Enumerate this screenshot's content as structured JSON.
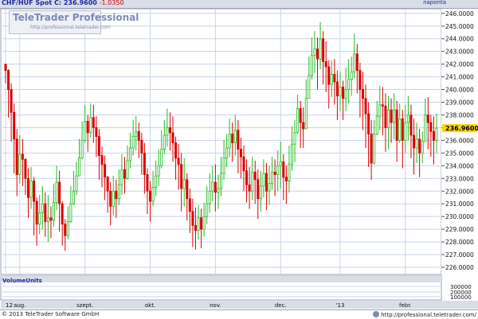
{
  "header": {
    "symbol_label": "CHF/HUF Spot",
    "last_label": "C: 236.9600",
    "change_label": "-1.0350",
    "period_label": "naponta"
  },
  "logo": {
    "name": "TeleTrader Professional",
    "url": "http://professional.teletrader.com"
  },
  "volume": {
    "label": "VolumeUnits",
    "ticks": [
      "300000",
      "200000",
      "100000"
    ]
  },
  "footer": {
    "copyright": "© 2013 TeleTrader Software GmbH",
    "url": "http://professional.teletrader.com/"
  },
  "colors": {
    "up": "#22bb22",
    "down": "#dd0000",
    "grid": "#c9d3e6",
    "axis_bg": "#d8dde8",
    "price_tag": "#ffd400"
  },
  "chart_data": {
    "type": "candlestick",
    "ylim": [
      225.5,
      246.3
    ],
    "yticks": [
      "226.0000",
      "227.0000",
      "228.0000",
      "229.0000",
      "230.0000",
      "231.0000",
      "232.0000",
      "233.0000",
      "234.0000",
      "235.0000",
      "236.0000",
      "237.0000",
      "238.0000",
      "239.0000",
      "240.0000",
      "241.0000",
      "242.0000",
      "243.0000",
      "244.0000",
      "245.0000",
      "246.0000"
    ],
    "last_price": "236.9600",
    "x_labels": [
      {
        "label": "12",
        "idx": 0
      },
      {
        "label": "aug.",
        "idx": 5
      },
      {
        "label": "szept.",
        "idx": 28
      },
      {
        "label": "okt.",
        "idx": 51
      },
      {
        "label": "nov.",
        "idx": 74
      },
      {
        "label": "dec.",
        "idx": 97
      },
      {
        "label": "'13",
        "idx": 118
      },
      {
        "label": "febr.",
        "idx": 141
      }
    ],
    "close": [
      241.5,
      240.0,
      238.2,
      236.1,
      233.3,
      234.9,
      234.5,
      233.0,
      231.5,
      232.8,
      231.2,
      229.4,
      230.3,
      231.0,
      229.6,
      229.9,
      229.7,
      231.1,
      232.7,
      231.0,
      229.4,
      228.5,
      229.6,
      231.0,
      232.0,
      233.2,
      234.6,
      236.0,
      237.5,
      236.6,
      237.8,
      237.0,
      236.3,
      234.8,
      234.1,
      233.1,
      232.0,
      230.8,
      232.0,
      231.4,
      232.5,
      233.7,
      233.0,
      234.4,
      235.4,
      236.3,
      236.7,
      236.0,
      235.0,
      233.3,
      232.0,
      231.2,
      232.3,
      233.2,
      234.0,
      235.3,
      236.4,
      237.0,
      236.6,
      235.8,
      234.6,
      234.1,
      232.2,
      232.9,
      231.4,
      230.4,
      229.3,
      228.9,
      229.9,
      229.0,
      230.0,
      231.0,
      232.0,
      232.7,
      231.9,
      232.2,
      233.4,
      234.6,
      235.4,
      236.5,
      235.8,
      236.8,
      235.3,
      234.7,
      233.6,
      232.5,
      232.0,
      233.5,
      232.9,
      231.4,
      232.4,
      233.4,
      232.0,
      232.6,
      233.5,
      233.3,
      234.0,
      234.3,
      233.1,
      232.8,
      234.1,
      235.7,
      236.6,
      238.5,
      237.4,
      236.9,
      239.3,
      241.1,
      242.7,
      243.2,
      242.4,
      244.0,
      242.2,
      241.8,
      240.4,
      241.2,
      240.6,
      239.5,
      240.2,
      239.3,
      240.0,
      240.8,
      241.4,
      242.8,
      241.5,
      240.0,
      239.3,
      238.1,
      236.5,
      234.2,
      236.5,
      237.9,
      238.8,
      238.7,
      237.0,
      238.4,
      237.4,
      238.4,
      236.0,
      237.7,
      236.0,
      237.4,
      238.0,
      236.4,
      235.4,
      236.1,
      235.0,
      235.9,
      238.0,
      237.4,
      236.7,
      236.0,
      236.96
    ],
    "high": [
      242.0,
      241.6,
      240.5,
      238.9,
      236.9,
      236.4,
      236.1,
      234.6,
      233.8,
      233.9,
      233.1,
      231.5,
      231.7,
      232.4,
      231.9,
      231.7,
      230.8,
      232.6,
      234.0,
      233.6,
      231.2,
      229.8,
      230.8,
      232.4,
      233.6,
      234.3,
      236.1,
      237.5,
      238.8,
      238.0,
      238.9,
      238.8,
      237.9,
      236.9,
      235.5,
      234.8,
      233.2,
      232.7,
      233.2,
      232.9,
      233.7,
      234.9,
      234.7,
      235.6,
      236.6,
      237.6,
      237.9,
      237.4,
      236.6,
      235.8,
      233.8,
      232.8,
      233.6,
      234.4,
      235.3,
      236.8,
      237.6,
      238.5,
      238.2,
      237.9,
      236.3,
      235.7,
      235.0,
      234.6,
      233.4,
      232.2,
      231.4,
      230.7,
      230.9,
      230.6,
      231.1,
      232.4,
      233.4,
      234.0,
      234.1,
      233.3,
      234.7,
      236.0,
      236.5,
      237.7,
      237.4,
      238.0,
      237.6,
      236.2,
      235.6,
      234.5,
      233.9,
      234.7,
      234.4,
      233.7,
      233.6,
      234.5,
      234.2,
      234.0,
      234.7,
      234.5,
      235.2,
      235.9,
      234.9,
      234.0,
      235.6,
      237.1,
      237.6,
      239.6,
      239.1,
      238.6,
      240.8,
      242.6,
      244.1,
      244.6,
      244.1,
      245.3,
      244.6,
      243.8,
      242.3,
      242.3,
      242.4,
      241.5,
      241.4,
      240.7,
      241.7,
      242.4,
      242.6,
      244.4,
      243.6,
      242.1,
      241.4,
      240.4,
      239.0,
      237.6,
      237.6,
      239.1,
      240.3,
      240.2,
      239.7,
      239.5,
      239.3,
      239.7,
      239.1,
      238.9,
      238.4,
      238.8,
      239.5,
      238.8,
      237.7,
      237.4,
      236.9,
      236.7,
      239.3,
      239.4,
      238.0,
      237.9,
      238.1
    ],
    "low": [
      240.5,
      237.8,
      235.9,
      233.4,
      231.6,
      232.6,
      232.4,
      231.7,
      229.9,
      230.6,
      228.5,
      227.7,
      228.6,
      229.0,
      228.4,
      228.0,
      228.3,
      229.2,
      230.5,
      228.8,
      227.7,
      227.3,
      228.2,
      229.5,
      230.9,
      231.7,
      233.2,
      234.5,
      235.8,
      235.1,
      236.2,
      235.8,
      234.7,
      232.9,
      232.3,
      231.3,
      230.3,
      229.3,
      230.1,
      229.9,
      230.9,
      231.7,
      231.8,
      232.9,
      233.8,
      234.8,
      235.2,
      234.6,
      233.3,
      231.8,
      230.2,
      229.6,
      230.8,
      231.6,
      232.4,
      233.8,
      234.9,
      235.5,
      235.2,
      234.3,
      232.9,
      232.1,
      230.4,
      230.8,
      229.7,
      228.7,
      227.6,
      227.4,
      228.2,
      227.5,
      228.4,
      229.4,
      230.3,
      231.2,
      230.4,
      230.6,
      231.6,
      232.9,
      233.9,
      234.7,
      234.3,
      234.8,
      233.4,
      233.0,
      232.0,
      231.1,
      230.6,
      231.3,
      231.0,
      229.8,
      230.4,
      231.5,
      230.5,
      230.9,
      232.1,
      231.6,
      232.0,
      232.2,
      231.3,
      231.0,
      231.9,
      233.6,
      234.3,
      236.5,
      235.4,
      235.4,
      237.1,
      239.5,
      240.8,
      241.3,
      240.0,
      241.6,
      240.4,
      239.8,
      238.5,
      239.4,
      238.8,
      237.6,
      238.3,
      237.6,
      238.3,
      238.9,
      239.5,
      240.9,
      239.7,
      237.8,
      236.8,
      235.4,
      233.9,
      232.9,
      234.1,
      236.4,
      236.8,
      236.4,
      235.1,
      235.3,
      235.8,
      236.1,
      234.3,
      235.8,
      233.8,
      235.0,
      236.0,
      234.6,
      233.3,
      234.2,
      233.1,
      234.2,
      236.0,
      235.3,
      234.7,
      234.1,
      235.0
    ]
  }
}
